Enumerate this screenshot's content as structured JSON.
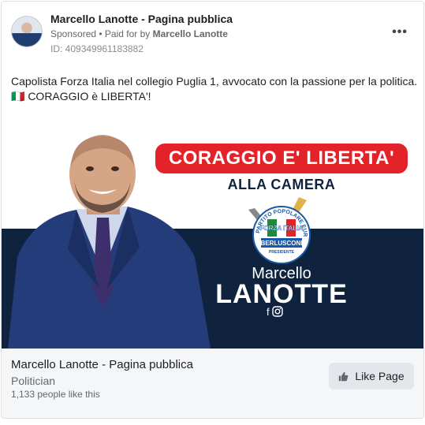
{
  "post": {
    "page_name": "Marcello Lanotte - Pagina pubblica",
    "sponsored": "Sponsored",
    "separator": " • ",
    "paid_prefix": "Paid for by ",
    "paid_by": "Marcello Lanotte",
    "ad_id": "ID: 409349961183882",
    "more_icon": "ellipsis-icon",
    "body_line1": "Capolista Forza Italia nel collegio Puglia 1, avvocato con la passione per la politica.",
    "body_line2": "🇮🇹 CORAGGIO è LIBERTA'!"
  },
  "creative": {
    "headline": "CORAGGIO E' LIBERTA'",
    "subline": "ALLA CAMERA",
    "logo_top_text": "PARTITO POPOLARE EUROPEO",
    "logo_flag_text": "FORZA ITALIA",
    "logo_name": "BERLUSCONI",
    "logo_role": "PRESIDENTE",
    "candidate_first": "Marcello",
    "candidate_last": "LANOTTE",
    "social_icons": [
      "facebook-icon",
      "instagram-icon"
    ],
    "colors": {
      "red": "#e2232a",
      "navy": "#10233e",
      "blue": "#1a58a8",
      "green": "#1f8a3b"
    }
  },
  "footer": {
    "page_name": "Marcello Lanotte - Pagina pubblica",
    "category": "Politician",
    "likes": "1,133 people like this",
    "like_button": "Like Page",
    "like_icon": "thumbs-up-icon"
  }
}
